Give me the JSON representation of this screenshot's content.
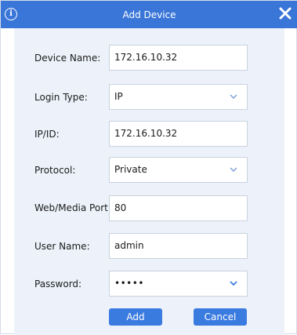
{
  "dialog": {
    "title": "Add Device",
    "info_icon_glyph": "i",
    "icons": {
      "info": "info-circle-icon",
      "close": "close-icon",
      "dropdown": "chevron-down-icon"
    }
  },
  "form": {
    "device_name": {
      "label": "Device Name:",
      "value": "172.16.10.32"
    },
    "login_type": {
      "label": "Login Type:",
      "value": "IP"
    },
    "ip_id": {
      "label": "IP/ID:",
      "value": "172.16.10.32"
    },
    "protocol": {
      "label": "Protocol:",
      "value": "Private"
    },
    "web_media_port": {
      "label": "Web/Media Port",
      "value": "80"
    },
    "user_name": {
      "label": "User Name:",
      "value": "admin"
    },
    "password": {
      "label": "Password:",
      "value": "•••••"
    }
  },
  "buttons": {
    "add": "Add",
    "cancel": "Cancel"
  },
  "colors": {
    "titlebar": "#3a76d8",
    "panel": "#edf2fa",
    "button": "#3a7be0",
    "chevron": "#7a9fd6",
    "chevron_active": "#3a7be0"
  }
}
